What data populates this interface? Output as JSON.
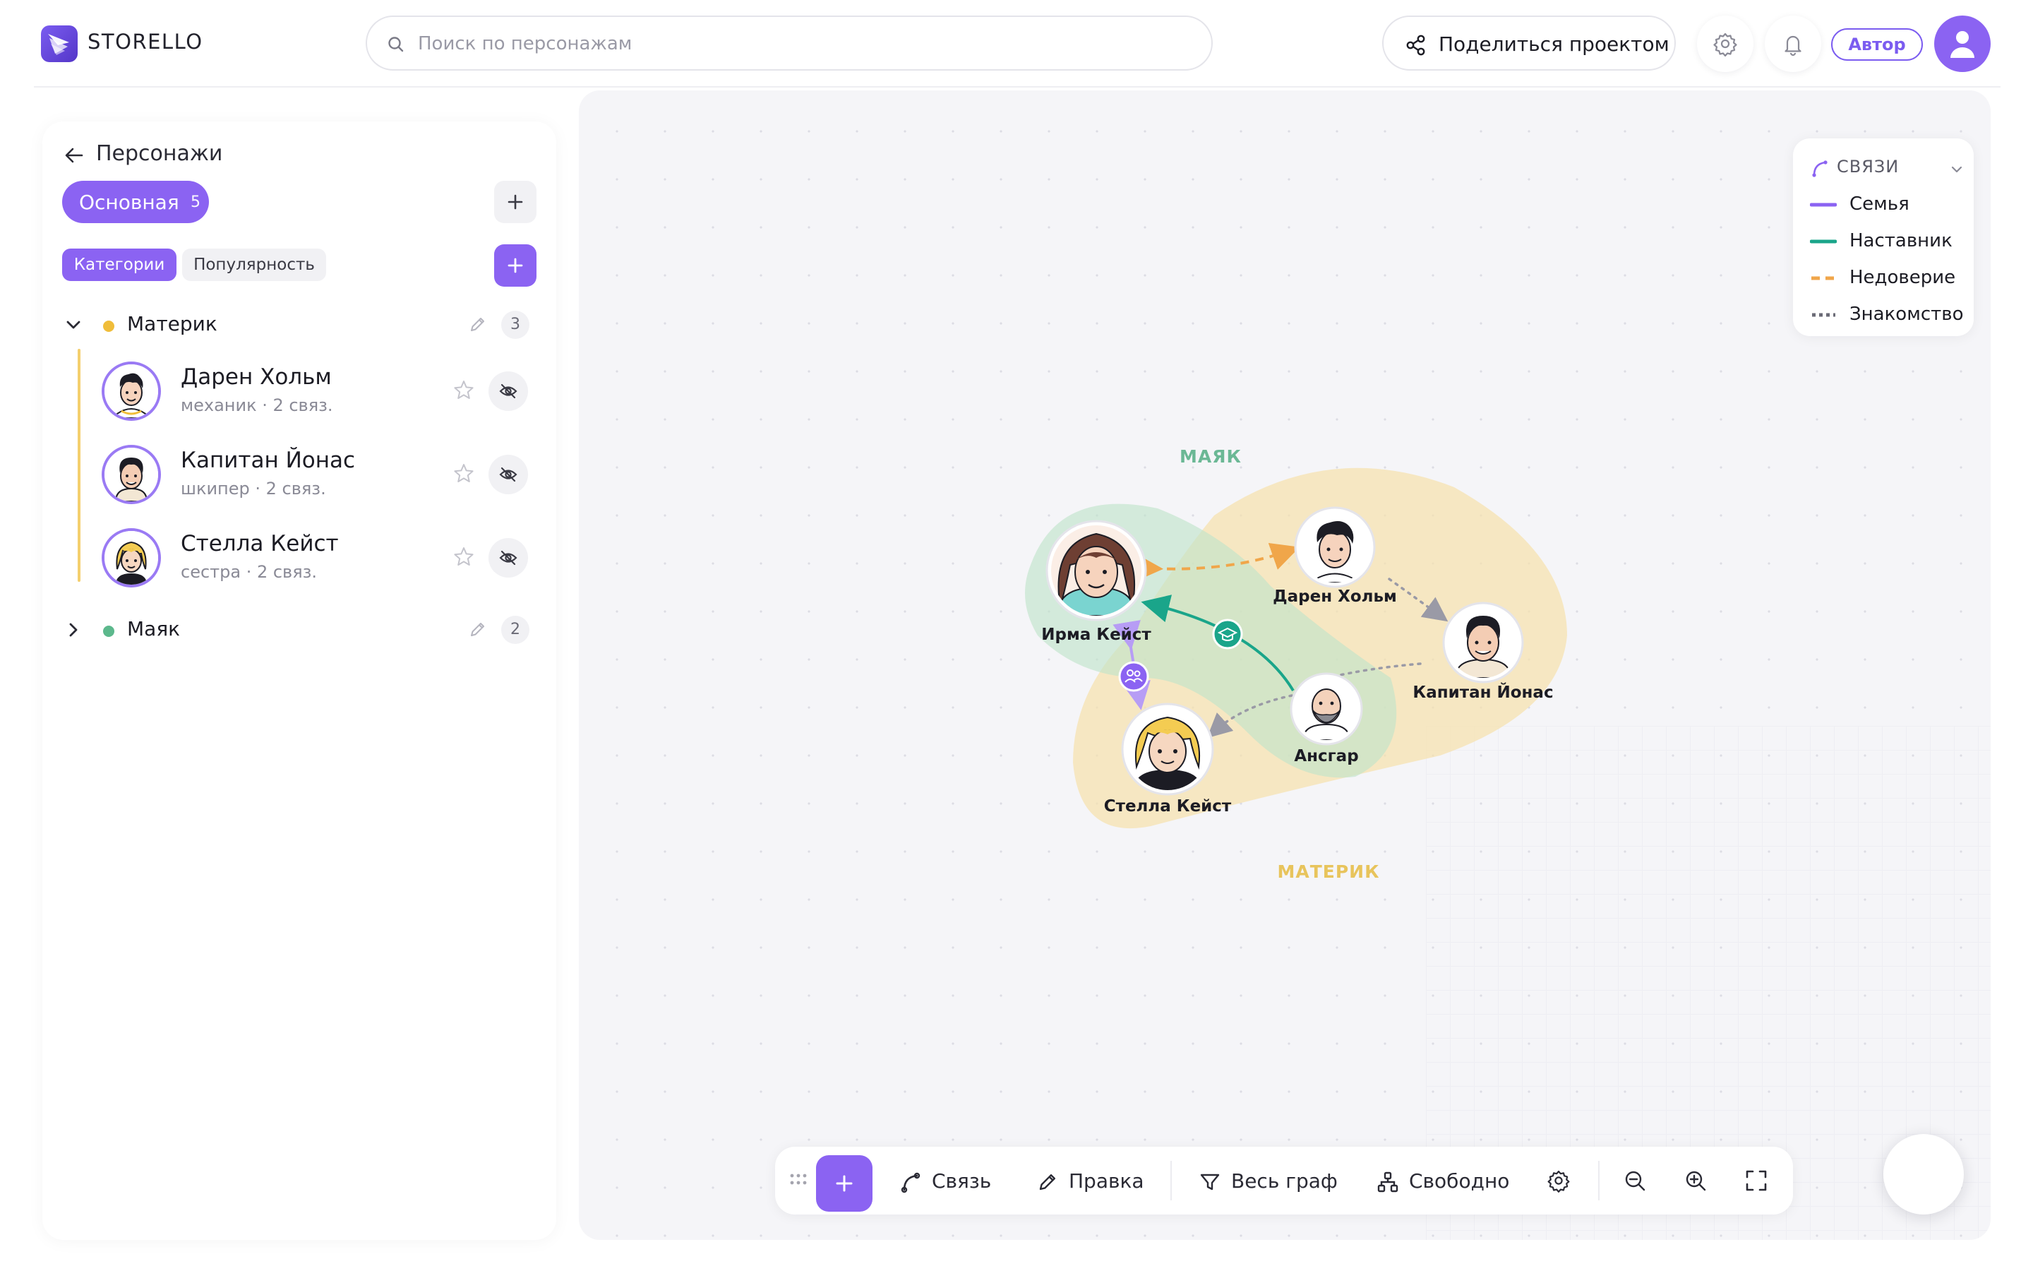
{
  "app": {
    "brand": "STORELLO"
  },
  "header": {
    "search_placeholder": "Поиск по персонажам",
    "share_label": "Поделиться проектом",
    "role_badge": "Автор",
    "accent": "#8b63f2"
  },
  "sidebar": {
    "back_label": "Персонажи",
    "active_set": {
      "label": "Основная",
      "count": "5"
    },
    "chips": [
      "Категории",
      "Популярность"
    ],
    "groups": [
      {
        "name": "Материк",
        "count": "3",
        "color": "#f0bd3a",
        "expanded": true
      },
      {
        "name": "Маяк",
        "count": "2",
        "color": "#5cb88c",
        "expanded": false
      }
    ],
    "characters": [
      {
        "name": "Дарен Хольм",
        "sub": "механик · 2 связ."
      },
      {
        "name": "Капитан Йонас",
        "sub": "шкипер · 2 связ."
      },
      {
        "name": "Стелла Кейст",
        "sub": "сестра · 2 связ."
      }
    ]
  },
  "canvas": {
    "regions": [
      {
        "label": "МАЯК",
        "color": "#6bb895"
      },
      {
        "label": "МАТЕРИК",
        "color": "#e8c45c"
      }
    ],
    "nodes": [
      {
        "label": "Ирма Кейст"
      },
      {
        "label": "Дарен Хольм"
      },
      {
        "label": "Капитан Йонас"
      },
      {
        "label": "Ансгар"
      },
      {
        "label": "Стелла Кейст"
      }
    ],
    "legend": {
      "title": "СВЯЗИ",
      "items": [
        {
          "label": "Семья",
          "color": "#8b63f2",
          "style": "solid"
        },
        {
          "label": "Наставник",
          "color": "#1aa58a",
          "style": "solid"
        },
        {
          "label": "Недоверие",
          "color": "#f0a64a",
          "style": "dashed"
        },
        {
          "label": "Знакомство",
          "color": "#6a6a76",
          "style": "dotted"
        }
      ]
    }
  },
  "toolbar": {
    "link": "Связь",
    "edit": "Правка",
    "filter": "Весь граф",
    "layout": "Свободно"
  }
}
